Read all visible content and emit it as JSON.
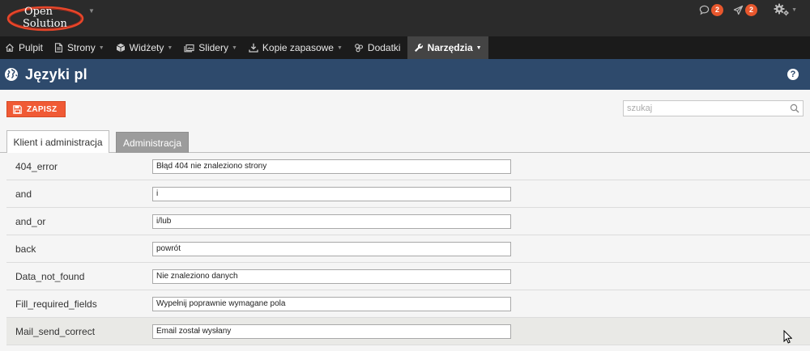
{
  "brand": {
    "logo_line1": "Open",
    "logo_line2": "Solution"
  },
  "header": {
    "messages_count": "2",
    "notifications_count": "2"
  },
  "menu": [
    {
      "id": "pulpit",
      "label": "Pulpit",
      "icon": "home-icon",
      "caret": false
    },
    {
      "id": "strony",
      "label": "Strony",
      "icon": "page-icon",
      "caret": true
    },
    {
      "id": "widzety",
      "label": "Widżety",
      "icon": "cube-icon",
      "caret": true
    },
    {
      "id": "slidery",
      "label": "Slidery",
      "icon": "slides-icon",
      "caret": true
    },
    {
      "id": "kopie",
      "label": "Kopie zapasowe",
      "icon": "download-icon",
      "caret": true
    },
    {
      "id": "dodatki",
      "label": "Dodatki",
      "icon": "plugin-icon",
      "caret": false
    },
    {
      "id": "narzedzia",
      "label": "Narzędzia",
      "icon": "wrench-icon",
      "caret": true,
      "active": true
    }
  ],
  "page": {
    "title": "Języki pl",
    "help": "?"
  },
  "toolbar": {
    "save_label": "ZAPISZ",
    "search_placeholder": "szukaj"
  },
  "tabs": [
    {
      "label": "Klient i administracja",
      "active": true
    },
    {
      "label": "Administracja",
      "active": false
    }
  ],
  "rows": [
    {
      "key": "404_error",
      "value": "Błąd 404 nie znaleziono strony"
    },
    {
      "key": "and",
      "value": "i"
    },
    {
      "key": "and_or",
      "value": "i/lub"
    },
    {
      "key": "back",
      "value": "powrót"
    },
    {
      "key": "Data_not_found",
      "value": "Nie znaleziono danych"
    },
    {
      "key": "Fill_required_fields",
      "value": "Wypełnij poprawnie wymagane pola"
    },
    {
      "key": "Mail_send_correct",
      "value": "Email został wysłany"
    }
  ],
  "colors": {
    "accent": "#f05a35",
    "titlebar": "#2e4a6c",
    "badge": "#e8572d"
  }
}
